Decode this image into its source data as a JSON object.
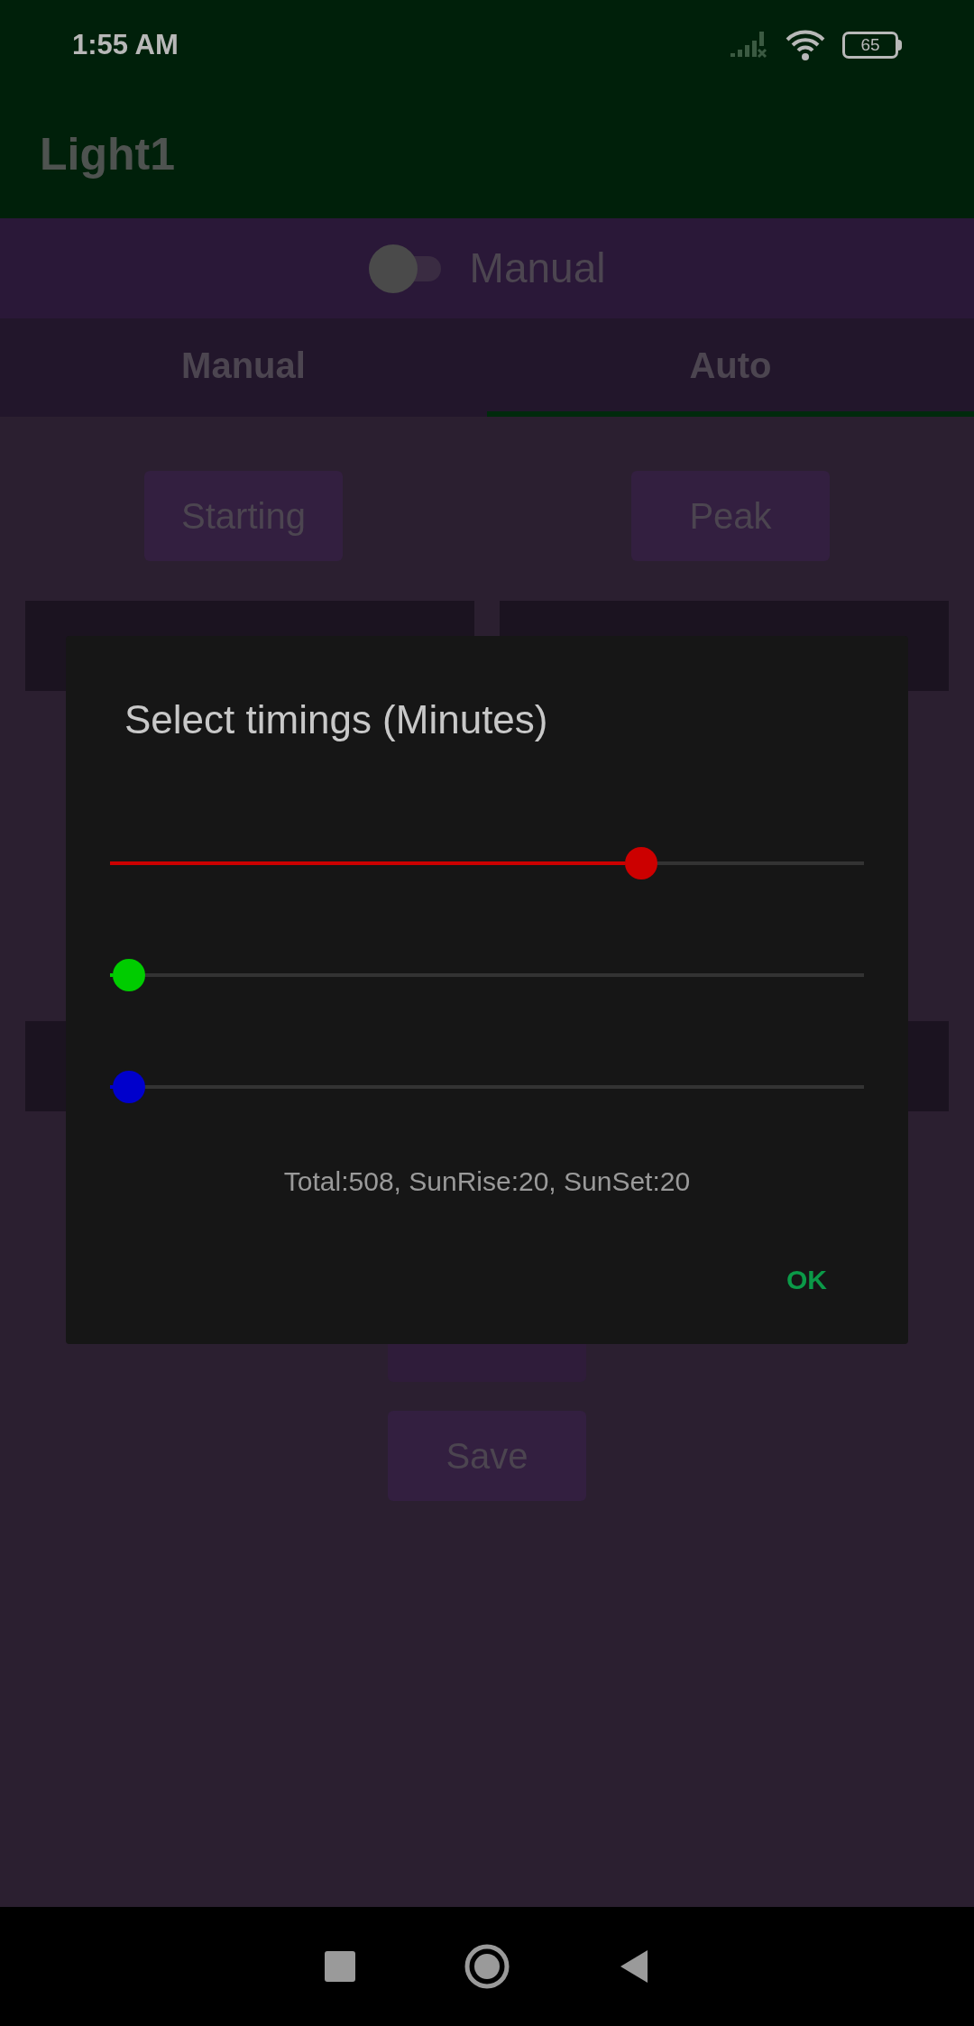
{
  "status_bar": {
    "time": "1:55 AM",
    "battery": "65"
  },
  "app_bar": {
    "title": "Light1"
  },
  "mode_switch": {
    "label": "Manual",
    "on": false
  },
  "tabs": [
    {
      "label": "Manual",
      "selected": false
    },
    {
      "label": "Auto",
      "selected": true
    }
  ],
  "preset_buttons": [
    "Starting",
    "Peak"
  ],
  "save_button": "Save",
  "dialog": {
    "title": "Select timings (Minutes)",
    "sliders": [
      {
        "level": 0.705,
        "color": "#cc0000"
      },
      {
        "level": 0.025,
        "color": "#00cc00"
      },
      {
        "level": 0.025,
        "color": "#0000cc"
      }
    ],
    "summary": "Total:508, SunRise:20, SunSet:20",
    "ok_button": "OK"
  }
}
